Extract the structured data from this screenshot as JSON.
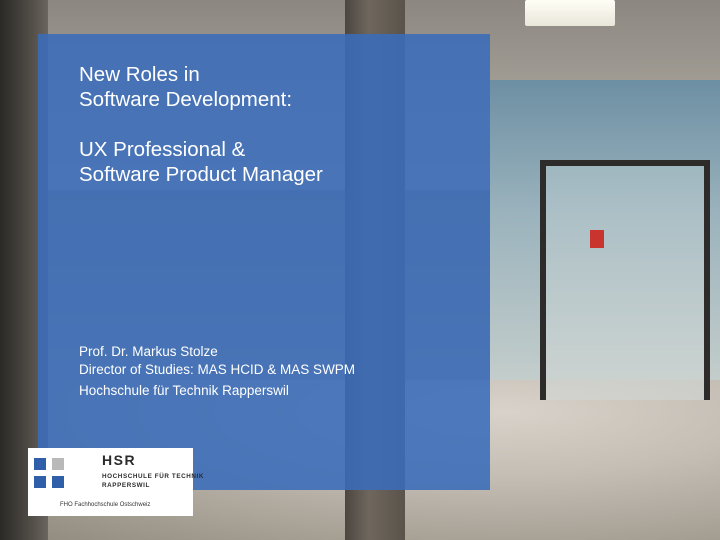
{
  "slide": {
    "title_lines_1": [
      "New Roles in",
      "Software Development:"
    ],
    "title_lines_2": [
      "UX Professional &",
      "Software Product Manager"
    ],
    "presenter_name": "Prof. Dr. Markus Stolze",
    "presenter_role": "Director of Studies: MAS HCID & MAS SWPM",
    "institution": "Hochschule für Technik Rapperswil"
  },
  "logo": {
    "abbr": "HSR",
    "line1": "HOCHSCHULE FÜR TECHNIK",
    "line2": "RAPPERSWIL",
    "subtitle": "FHO Fachhochschule Ostschweiz"
  },
  "colors": {
    "overlay_blue": "#3a6cba",
    "logo_blue": "#2f5fa8",
    "logo_grey": "#b9b9b9"
  }
}
